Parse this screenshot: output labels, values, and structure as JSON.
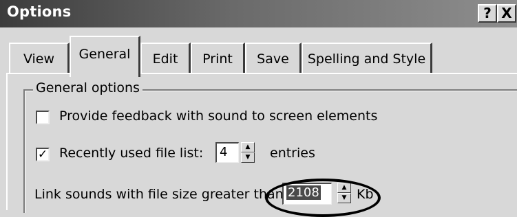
{
  "window": {
    "title": "Options",
    "help_button": "?",
    "close_button": "X"
  },
  "tabs": [
    {
      "label": "View",
      "active": false
    },
    {
      "label": "General",
      "active": true
    },
    {
      "label": "Edit",
      "active": false
    },
    {
      "label": "Print",
      "active": false
    },
    {
      "label": "Save",
      "active": false
    },
    {
      "label": "Spelling and Style",
      "active": false
    }
  ],
  "general_options": {
    "legend": "General options",
    "feedback_sound": {
      "label": "Provide feedback with sound to screen elements",
      "checked": false,
      "mark": ""
    },
    "recent_files": {
      "label": "Recently used file list:",
      "checked": true,
      "mark": "✓",
      "value": "4",
      "suffix": "entries"
    },
    "link_sounds": {
      "label": "Link sounds with file size greater than",
      "value": "2108",
      "suffix": "Kb"
    }
  },
  "colors": {
    "titlebar_start": "#3c3c3c",
    "titlebar_end": "#8e8e8e",
    "dialog_bg": "#d8d8d8"
  }
}
